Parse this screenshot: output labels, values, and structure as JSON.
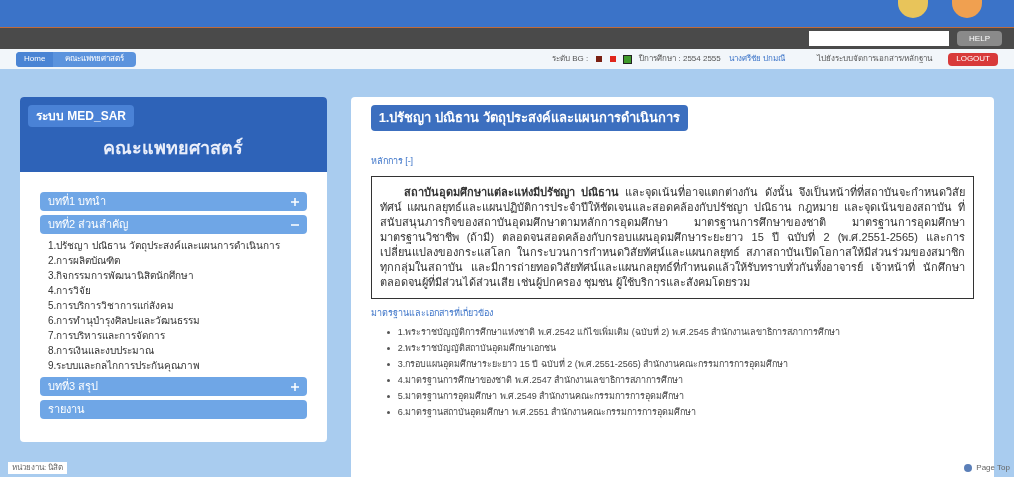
{
  "toolbar": {
    "help_button": "HELP"
  },
  "breadcrumb": [
    "Home",
    "คณะแพทยศาสตร์"
  ],
  "user_bar": {
    "bg_label": "ระดับ BG :",
    "bg_levels": [
      {
        "color": "#7a1f12",
        "selected": false
      },
      {
        "color": "#e0261b",
        "selected": false
      },
      {
        "color": "#3f9a2a",
        "selected": true
      }
    ],
    "year_label": "ปีการศึกษา : 2554 2555",
    "user": "นางศรีชัย ปกมณี",
    "docs_link": "ไปยังระบบจัดการเอกสาร/หลักฐาน",
    "logout": "LOGOUT"
  },
  "sidebar": {
    "system": "ระบบ MED_SAR",
    "faculty": "คณะแพทยศาสตร์",
    "sections": [
      {
        "label": "บทที่1 บทนำ",
        "expanded": false
      },
      {
        "label": "บทที่2 ส่วนสำคัญ",
        "expanded": true,
        "children": [
          "1.ปรัชญา ปณิธาน วัตถุประสงค์และแผนการดำเนินการ",
          "2.การผลิตบัณฑิต",
          "3.กิจกรรมการพัฒนานิสิตนักศึกษา",
          "4.การวิจัย",
          "5.การบริการวิชาการแก่สังคม",
          "6.การทำนุบำรุงศิลปะและวัฒนธรรม",
          "7.การบริหารและการจัดการ",
          "8.การเงินและงบประมาณ",
          "9.ระบบและกลไกการประกันคุณภาพ"
        ]
      },
      {
        "label": "บทที่3 สรุป",
        "expanded": false
      },
      {
        "label": "รายงาน"
      }
    ]
  },
  "content": {
    "title": "1.ปรัชญา ปณิธาน วัตถุประสงค์และแผนการดำเนินการ",
    "principle_toggle": "หลักการ [-]",
    "principle_text": "**สถาบันอุดมศึกษาแต่ละแห่งมีปรัชญา ปณิธาน** และจุดเน้นที่อาจแตกต่างกัน ดังนั้น จึงเป็นหน้าที่ที่สถาบันจะกำหนดวิสัยทัศน์ แผนกลยุทธ์และแผนปฏิบัติการประจำปีให้ชัดเจนและสอดคล้องกับปรัชญา ปณิธาน กฎหมาย และจุดเน้นของสถาบัน ที่สนับสนุนภารกิจของสถาบันอุดมศึกษาตามหลักการอุดมศึกษา มาตรฐานการศึกษาของชาติ มาตรฐานการอุดมศึกษา มาตรฐานวิชาชีพ (ถ้ามี) ตลอดจนสอดคล้องกับกรอบแผนอุดมศึกษาระยะยาว 15 ปี ฉบับที่ 2 (พ.ศ.2551-2565) และการเปลี่ยนแปลงของกระแสโลก ในกระบวนการกำหนดวิสัยทัศน์และแผนกลยุทธ์ สภาสถาบันเปิดโอกาสให้มีส่วนร่วมของสมาชิกทุกกลุ่มในสถาบัน และมีการถ่ายทอดวิสัยทัศน์และแผนกลยุทธ์ที่กำหนดแล้วให้รับทราบทั่วกันทั้งอาจารย์ เจ้าหน้าที่ นักศึกษา ตลอดจนผู้ที่มีส่วนได้ส่วนเสีย เช่นผู้ปกครอง ชุมชน ผู้ใช้บริการและสังคมโดยรวม",
    "references_heading": "มาตรฐานและเอกสารที่เกี่ยวข้อง",
    "references": [
      "1.พระราชบัญญัติการศึกษาแห่งชาติ พ.ศ.2542 แก้ไขเพิ่มเติม (ฉบับที่ 2) พ.ศ.2545 สำนักงานเลขาธิการสภาการศึกษา",
      "2.พระราชบัญญัติสถาบันอุดมศึกษาเอกชน",
      "3.กรอบแผนอุดมศึกษาระยะยาว 15 ปี ฉบับที่ 2 (พ.ศ.2551-2565) สำนักงานคณะกรรมการการอุดมศึกษา",
      "4.มาตรฐานการศึกษาของชาติ พ.ศ.2547 สำนักงานเลขาธิการสภาการศึกษา",
      "5.มาตรฐานการอุดมศึกษา พ.ศ.2549 สำนักงานคณะกรรมการการอุดมศึกษา",
      "6.มาตรฐานสถาบันอุดมศึกษา พ.ศ.2551 สำนักงานคณะกรรมการการอุดมศึกษา"
    ]
  },
  "footer": {
    "unit": "หน่วยงาน: นิสิต",
    "page_top": "Page Top"
  }
}
